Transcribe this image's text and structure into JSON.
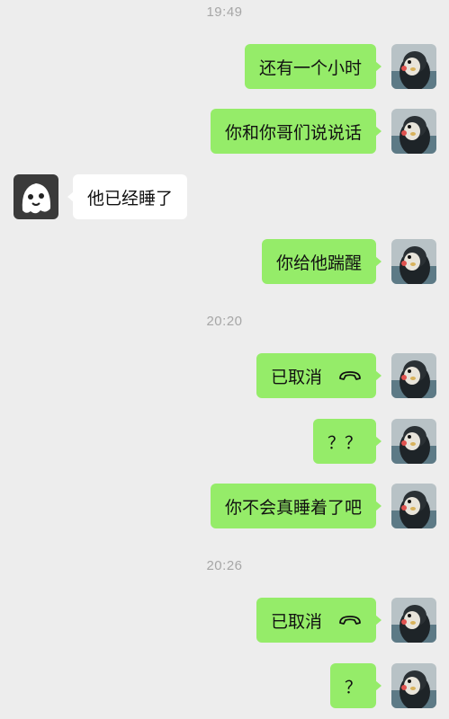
{
  "colors": {
    "background": "#ededed",
    "outgoing_bubble": "#95ec69",
    "incoming_bubble": "#ffffff",
    "timestamp_text": "#a6a6a6"
  },
  "timestamps": [
    "19:49",
    "20:20",
    "20:26"
  ],
  "messages": [
    {
      "side": "out",
      "text": "还有一个小时"
    },
    {
      "side": "out",
      "text": "你和你哥们说说话"
    },
    {
      "side": "in",
      "text": "他已经睡了"
    },
    {
      "side": "out",
      "text": "你给他踹醒"
    },
    {
      "side": "out",
      "text": "已取消",
      "icon": "phone-hangup-icon"
    },
    {
      "side": "out",
      "text": "？？"
    },
    {
      "side": "out",
      "text": "你不会真睡着了吧"
    },
    {
      "side": "out",
      "text": "已取消",
      "icon": "phone-hangup-icon"
    },
    {
      "side": "out",
      "text": "？"
    }
  ],
  "avatars": {
    "self": "penguin-avatar",
    "contact": "ghost-cartoon-avatar"
  }
}
